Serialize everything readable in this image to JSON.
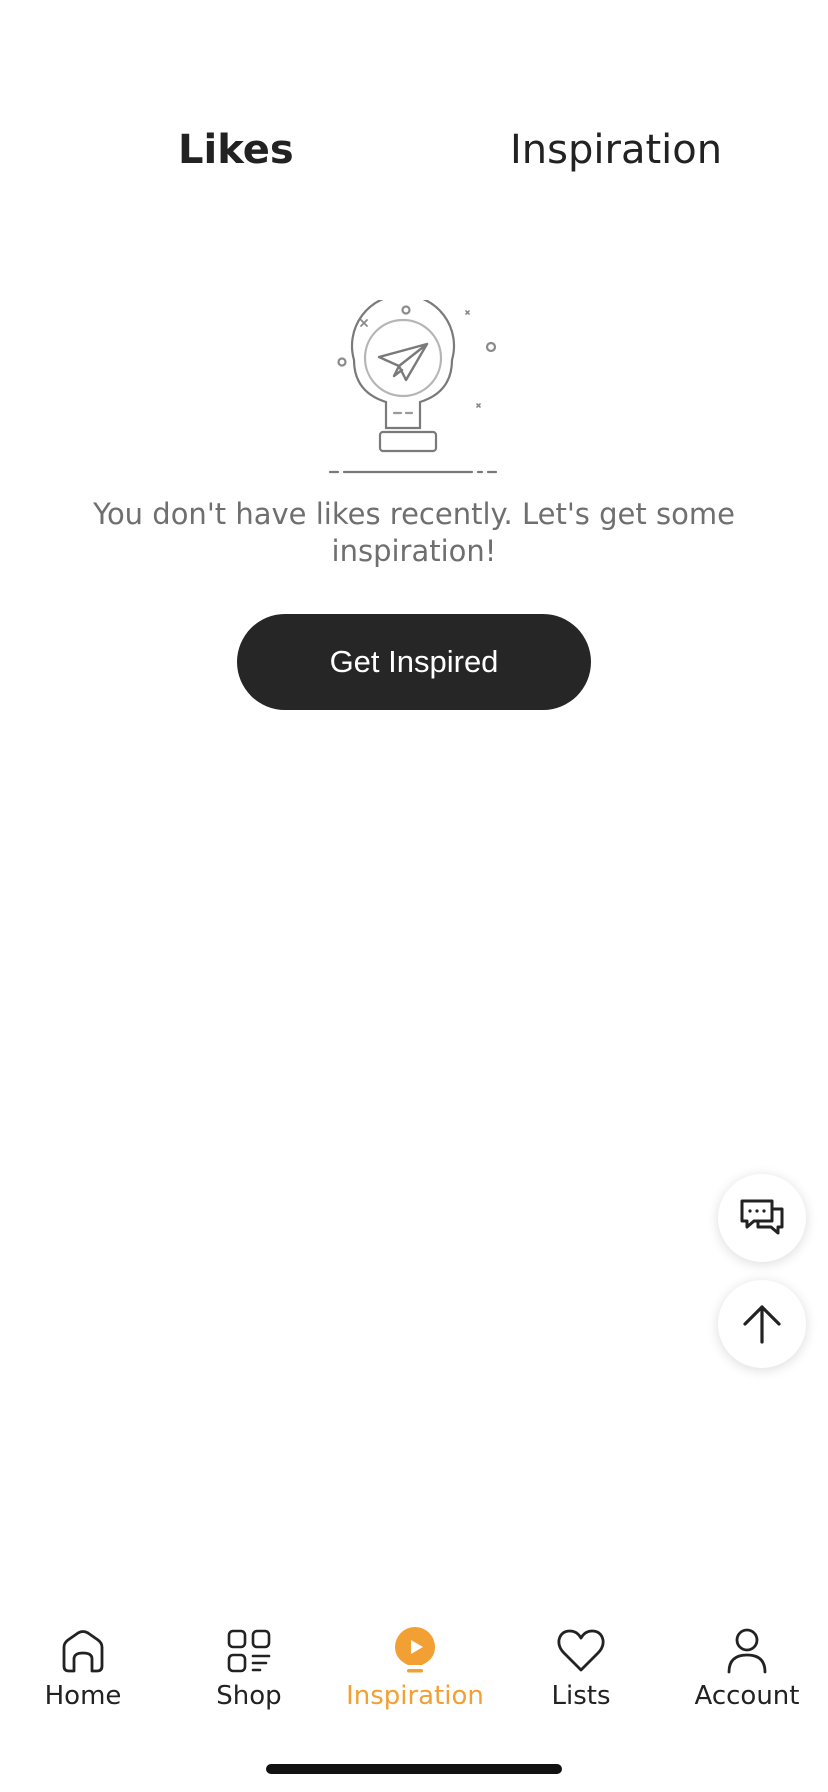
{
  "tabs": [
    {
      "label": "Likes",
      "active": true
    },
    {
      "label": "Inspiration",
      "active": false
    }
  ],
  "empty_state": {
    "icon": "lightbulb-paper-plane-icon",
    "message": "You don't have likes recently. Let's get some inspiration!",
    "button_label": "Get Inspired"
  },
  "floating_buttons": {
    "chat_icon": "chat-bubbles-icon",
    "top_icon": "arrow-up-icon"
  },
  "bottom_nav": [
    {
      "label": "Home",
      "icon": "home-icon",
      "active": false
    },
    {
      "label": "Shop",
      "icon": "shop-grid-icon",
      "active": false
    },
    {
      "label": "Inspiration",
      "icon": "inspiration-bulb-icon",
      "active": true
    },
    {
      "label": "Lists",
      "icon": "heart-icon",
      "active": false
    },
    {
      "label": "Account",
      "icon": "person-icon",
      "active": false
    }
  ],
  "colors": {
    "accent": "#f2a033",
    "button_dark": "#262626",
    "text_muted": "#6f6f6f"
  }
}
